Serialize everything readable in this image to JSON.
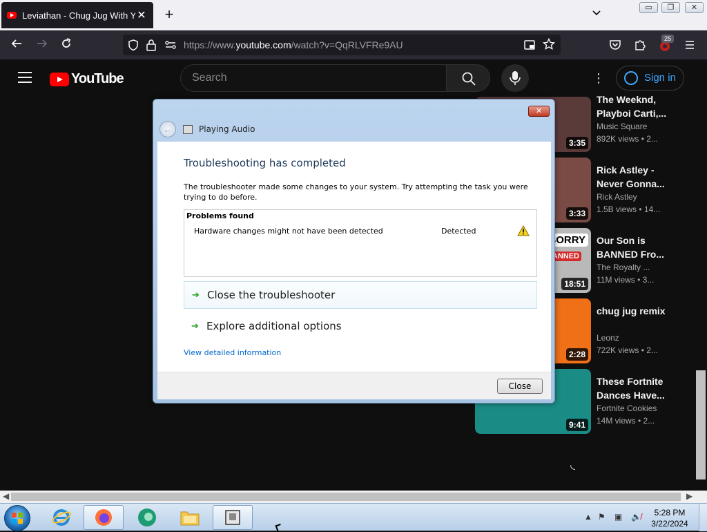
{
  "browser": {
    "tab_title": "Leviathan - Chug Jug With You",
    "tab_close": "✕",
    "new_tab": "+",
    "url_prefix": "https://www.",
    "url_host": "youtube.com",
    "url_path": "/watch?v=QqRLVFRe9AU",
    "extension_badge": "25"
  },
  "youtube": {
    "logo_text": "YouTube",
    "search_placeholder": "Search",
    "signin_label": "Sign in",
    "recommended": [
      {
        "title_line1": "The Weeknd,",
        "title_line2": "Playboi Carti,...",
        "channel": "Music Square",
        "meta": "892K views  • 2...",
        "duration": "3:35",
        "thumb_color": "#5b3a3a"
      },
      {
        "title_line1": "Rick Astley -",
        "title_line2": "Never Gonna...",
        "channel": "Rick Astley",
        "meta": "1.5B views  • 14...",
        "duration": "3:33",
        "thumb_color": "#7a4a44"
      },
      {
        "title_line1": "Our Son is",
        "title_line2": "BANNED Fro...",
        "channel": "The Royalty ...",
        "meta": "11M views  • 3...",
        "duration": "18:51",
        "thumb_color": "#b9b9b9",
        "thumb_text1": "SORRY",
        "thumb_text2": "BANNED"
      },
      {
        "title_line1": "chug jug remix",
        "title_line2": "",
        "channel": "Leonz",
        "meta": "722K views  • 2...",
        "duration": "2:28",
        "thumb_color": "#f07018"
      },
      {
        "title_line1": "These Fortnite",
        "title_line2": "Dances Have...",
        "channel": "Fortnite Cookies",
        "meta": "14M views  • 2...",
        "duration": "9:41",
        "thumb_color": "#1a8c85"
      }
    ]
  },
  "dialog": {
    "title": "Playing Audio",
    "close_glyph": "✕",
    "heading": "Troubleshooting has completed",
    "description": "The troubleshooter made some changes to your system. Try attempting the task you were trying to do before.",
    "problems_header": "Problems found",
    "problem_name": "Hardware changes might not have been detected",
    "problem_status": "Detected",
    "option1": "Close the troubleshooter",
    "option2": "Explore additional options",
    "view_details": "View detailed information",
    "close_button": "Close"
  },
  "taskbar": {
    "time": "5:28 PM",
    "date": "3/22/2024"
  }
}
